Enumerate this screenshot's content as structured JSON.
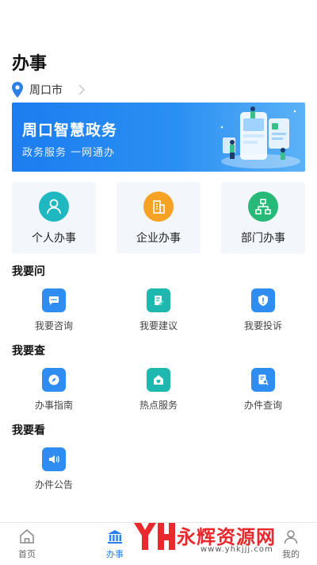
{
  "header": {
    "title": "办事"
  },
  "location": {
    "city": "周口市"
  },
  "banner": {
    "title": "周口智慧政务",
    "subtitle": "政务服务 一网通办"
  },
  "cards": [
    {
      "label": "个人办事",
      "icon": "person-icon",
      "color": "#1fb8c0"
    },
    {
      "label": "企业办事",
      "icon": "building-icon",
      "color": "#f6a224"
    },
    {
      "label": "部门办事",
      "icon": "org-chart-icon",
      "color": "#27b978"
    }
  ],
  "sections": [
    {
      "title": "我要问",
      "items": [
        {
          "label": "我要咨询",
          "icon": "chat-icon",
          "color": "#2f8df2"
        },
        {
          "label": "我要建议",
          "icon": "edit-doc-icon",
          "color": "#1fb8b0"
        },
        {
          "label": "我要投诉",
          "icon": "shield-alert-icon",
          "color": "#2f8df2"
        }
      ]
    },
    {
      "title": "我要查",
      "items": [
        {
          "label": "办事指南",
          "icon": "compass-icon",
          "color": "#2f8df2"
        },
        {
          "label": "热点服务",
          "icon": "home-heart-icon",
          "color": "#1fb8b0"
        },
        {
          "label": "办件查询",
          "icon": "doc-search-icon",
          "color": "#2f8df2"
        }
      ]
    },
    {
      "title": "我要看",
      "items": [
        {
          "label": "办件公告",
          "icon": "speaker-icon",
          "color": "#2f8df2"
        }
      ]
    }
  ],
  "tabbar": [
    {
      "label": "首页",
      "icon": "home-icon",
      "active": false
    },
    {
      "label": "办事",
      "icon": "government-building-icon",
      "active": true
    },
    {
      "label": "",
      "icon": "",
      "active": false
    },
    {
      "label": "",
      "icon": "",
      "active": false
    },
    {
      "label": "我的",
      "icon": "user-icon",
      "active": false
    }
  ],
  "watermark": {
    "text": "永辉资源网",
    "url": "www.yhkjjj.com"
  }
}
